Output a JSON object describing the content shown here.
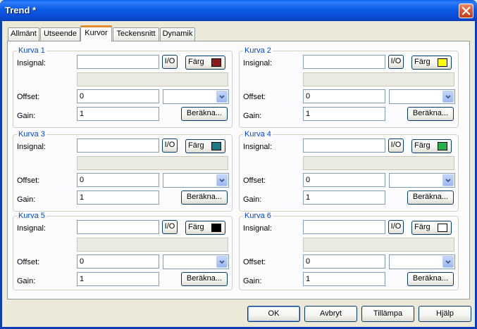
{
  "window": {
    "title": "Trend *"
  },
  "tabs": [
    "Allmänt",
    "Utseende",
    "Kurvor",
    "Teckensnitt",
    "Dynamik"
  ],
  "active_tab": "Kurvor",
  "labels": {
    "insignal": "Insignal:",
    "offset": "Offset:",
    "gain": "Gain:",
    "io_button": "I/O",
    "color_button": "Färg",
    "calculate_button": "Beräkna..."
  },
  "curves": [
    {
      "title": "Kurva 1",
      "offset": "0",
      "gain": "1",
      "color": "#8b1a1a"
    },
    {
      "title": "Kurva 2",
      "offset": "0",
      "gain": "1",
      "color": "#ffff00"
    },
    {
      "title": "Kurva 3",
      "offset": "0",
      "gain": "1",
      "color": "#1a7a8c"
    },
    {
      "title": "Kurva 4",
      "offset": "0",
      "gain": "1",
      "color": "#22b34a"
    },
    {
      "title": "Kurva 5",
      "offset": "0",
      "gain": "1",
      "color": "#000000"
    },
    {
      "title": "Kurva 6",
      "offset": "0",
      "gain": "1",
      "color": "#ffffff"
    }
  ],
  "buttons": {
    "ok": "OK",
    "cancel": "Avbryt",
    "apply": "Tillämpa",
    "help": "Hjälp"
  }
}
